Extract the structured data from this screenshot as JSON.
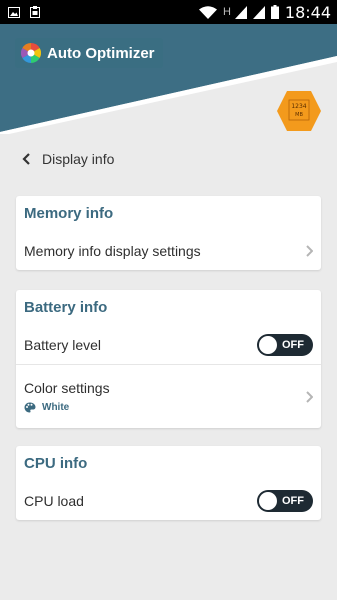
{
  "status_bar": {
    "network_letter": "H",
    "time": "18:44",
    "icons": [
      "image-icon",
      "clipboard-icon",
      "wifi-icon",
      "signal-icon",
      "signal-icon-2",
      "battery-icon"
    ]
  },
  "header": {
    "app_title": "Auto Optimizer",
    "badge_text_top": "1234",
    "badge_text_bottom": "MB",
    "banner_color": "#3d6e84",
    "badge_color": "#f39a1c"
  },
  "breadcrumb": {
    "label": "Display info"
  },
  "sections": {
    "memory": {
      "title": "Memory info",
      "rows": [
        {
          "label": "Memory info display settings"
        }
      ]
    },
    "battery": {
      "title": "Battery info",
      "battery_level_label": "Battery level",
      "battery_level_toggle": "OFF",
      "color_settings_label": "Color settings",
      "color_settings_value": "White"
    },
    "cpu": {
      "title": "CPU info",
      "cpu_load_label": "CPU load",
      "cpu_load_toggle": "OFF"
    }
  }
}
